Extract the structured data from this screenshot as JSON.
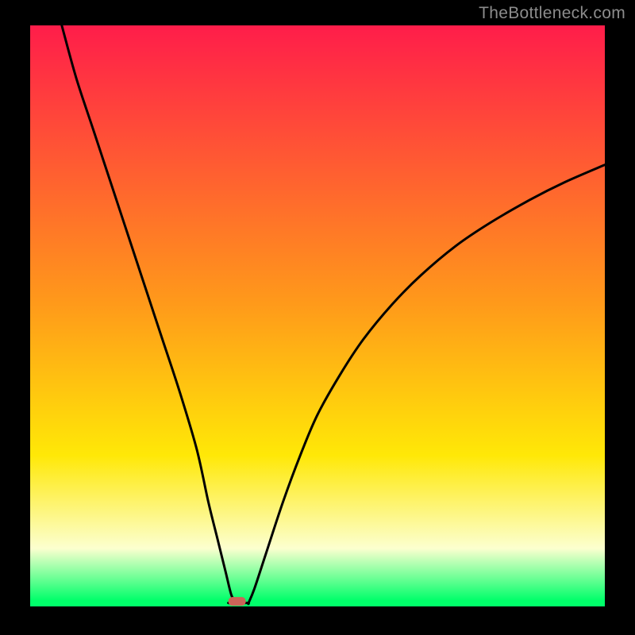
{
  "watermark": "TheBottleneck.com",
  "chart_data": {
    "type": "line",
    "title": "",
    "xlabel": "",
    "ylabel": "",
    "xlim": [
      0,
      100
    ],
    "ylim": [
      0,
      100
    ],
    "grid": false,
    "legend": false,
    "background_gradient": {
      "top": "#ff1d4a",
      "middle": "#ffe807",
      "bottom": "#00ff6a"
    },
    "marker": {
      "x": 36,
      "y": 0.8,
      "color": "#cc6458"
    },
    "series": [
      {
        "name": "left-branch",
        "x": [
          5.5,
          8,
          11,
          14,
          17,
          20,
          23,
          26,
          29,
          31,
          32.5,
          34,
          35,
          35.8
        ],
        "values": [
          100,
          91,
          82,
          73,
          64,
          55,
          46,
          37,
          27,
          18,
          12,
          6,
          2,
          0.5
        ]
      },
      {
        "name": "flat-bottom",
        "x": [
          34.5,
          35,
          36,
          37,
          38
        ],
        "values": [
          0.6,
          0.6,
          0.6,
          0.6,
          0.6
        ]
      },
      {
        "name": "right-branch",
        "x": [
          38,
          39,
          41,
          44,
          47,
          50,
          54,
          58,
          63,
          68,
          74,
          80,
          87,
          93,
          100
        ],
        "values": [
          0.6,
          3,
          9,
          18,
          26,
          33,
          40,
          46,
          52,
          57,
          62,
          66,
          70,
          73,
          76
        ]
      }
    ]
  }
}
